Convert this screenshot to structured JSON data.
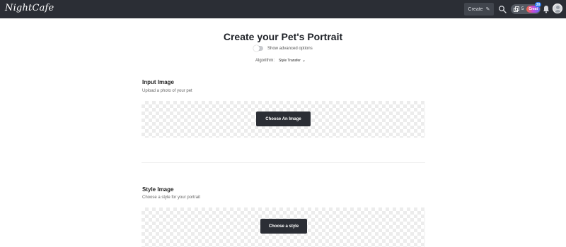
{
  "header": {
    "logo_text": "NightCafe",
    "create_label": "Create",
    "credits_count": "5",
    "pro_badge": "Creat",
    "notification_count": "30",
    "icons": [
      "pencil-icon",
      "search-icon",
      "credits-stack-icon",
      "bell-icon",
      "avatar"
    ]
  },
  "main": {
    "title": "Create your Pet's Portrait",
    "advanced_toggle_label": "Show advanced options",
    "advanced_toggle_on": false,
    "algorithm_label": "Algorithm:",
    "algorithm_value": "Style Transfer"
  },
  "input_section": {
    "title": "Input Image",
    "subtitle": "Upload a photo of your pet",
    "button_label": "Choose An Image"
  },
  "style_section": {
    "title": "Style Image",
    "subtitle": "Choose a style for your portrait",
    "button_label": "Choose a style"
  },
  "colors": {
    "topbar": "#2b2e35",
    "button_dark": "#2b2e35",
    "notification_badge": "#2f7bf0"
  }
}
